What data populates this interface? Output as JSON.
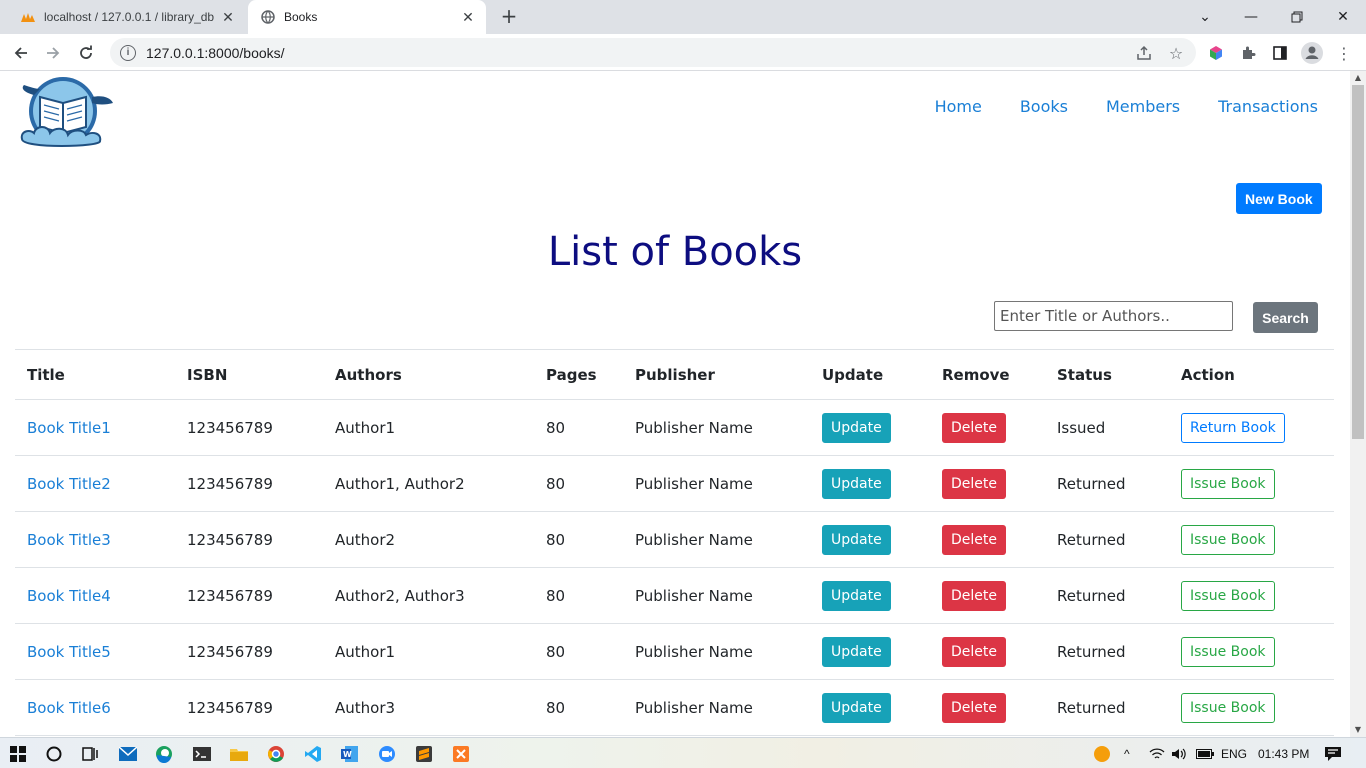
{
  "browser": {
    "tabs": [
      {
        "title": "localhost / 127.0.0.1 / library_db |",
        "active": false
      },
      {
        "title": "Books",
        "active": true
      }
    ],
    "url": "127.0.0.1:8000/books/"
  },
  "nav": {
    "items": [
      "Home",
      "Books",
      "Members",
      "Transactions"
    ]
  },
  "page": {
    "new_book_label": "New Book",
    "title": "List of Books",
    "search_placeholder": "Enter Title or Authors..",
    "search_label": "Search"
  },
  "table": {
    "headers": [
      "Title",
      "ISBN",
      "Authors",
      "Pages",
      "Publisher",
      "Update",
      "Remove",
      "Status",
      "Action"
    ],
    "rows": [
      {
        "title": "Book Title1",
        "isbn": "123456789",
        "authors": "Author1",
        "pages": "80",
        "publisher": "Publisher Name",
        "update": "Update",
        "remove": "Delete",
        "status": "Issued",
        "action": "Return Book"
      },
      {
        "title": "Book Title2",
        "isbn": "123456789",
        "authors": "Author1, Author2",
        "pages": "80",
        "publisher": "Publisher Name",
        "update": "Update",
        "remove": "Delete",
        "status": "Returned",
        "action": "Issue Book"
      },
      {
        "title": "Book Title3",
        "isbn": "123456789",
        "authors": "Author2",
        "pages": "80",
        "publisher": "Publisher Name",
        "update": "Update",
        "remove": "Delete",
        "status": "Returned",
        "action": "Issue Book"
      },
      {
        "title": "Book Title4",
        "isbn": "123456789",
        "authors": "Author2, Author3",
        "pages": "80",
        "publisher": "Publisher Name",
        "update": "Update",
        "remove": "Delete",
        "status": "Returned",
        "action": "Issue Book"
      },
      {
        "title": "Book Title5",
        "isbn": "123456789",
        "authors": "Author1",
        "pages": "80",
        "publisher": "Publisher Name",
        "update": "Update",
        "remove": "Delete",
        "status": "Returned",
        "action": "Issue Book"
      },
      {
        "title": "Book Title6",
        "isbn": "123456789",
        "authors": "Author3",
        "pages": "80",
        "publisher": "Publisher Name",
        "update": "Update",
        "remove": "Delete",
        "status": "Returned",
        "action": "Issue Book"
      }
    ]
  },
  "taskbar": {
    "language": "ENG",
    "time": "01:43 PM"
  },
  "colors": {
    "primary": "#007bff",
    "info": "#17a2b8",
    "danger": "#dc3545",
    "success": "#28a745",
    "secondary": "#6c757d",
    "title": "#0d0d80",
    "link": "#1a7fd6"
  }
}
